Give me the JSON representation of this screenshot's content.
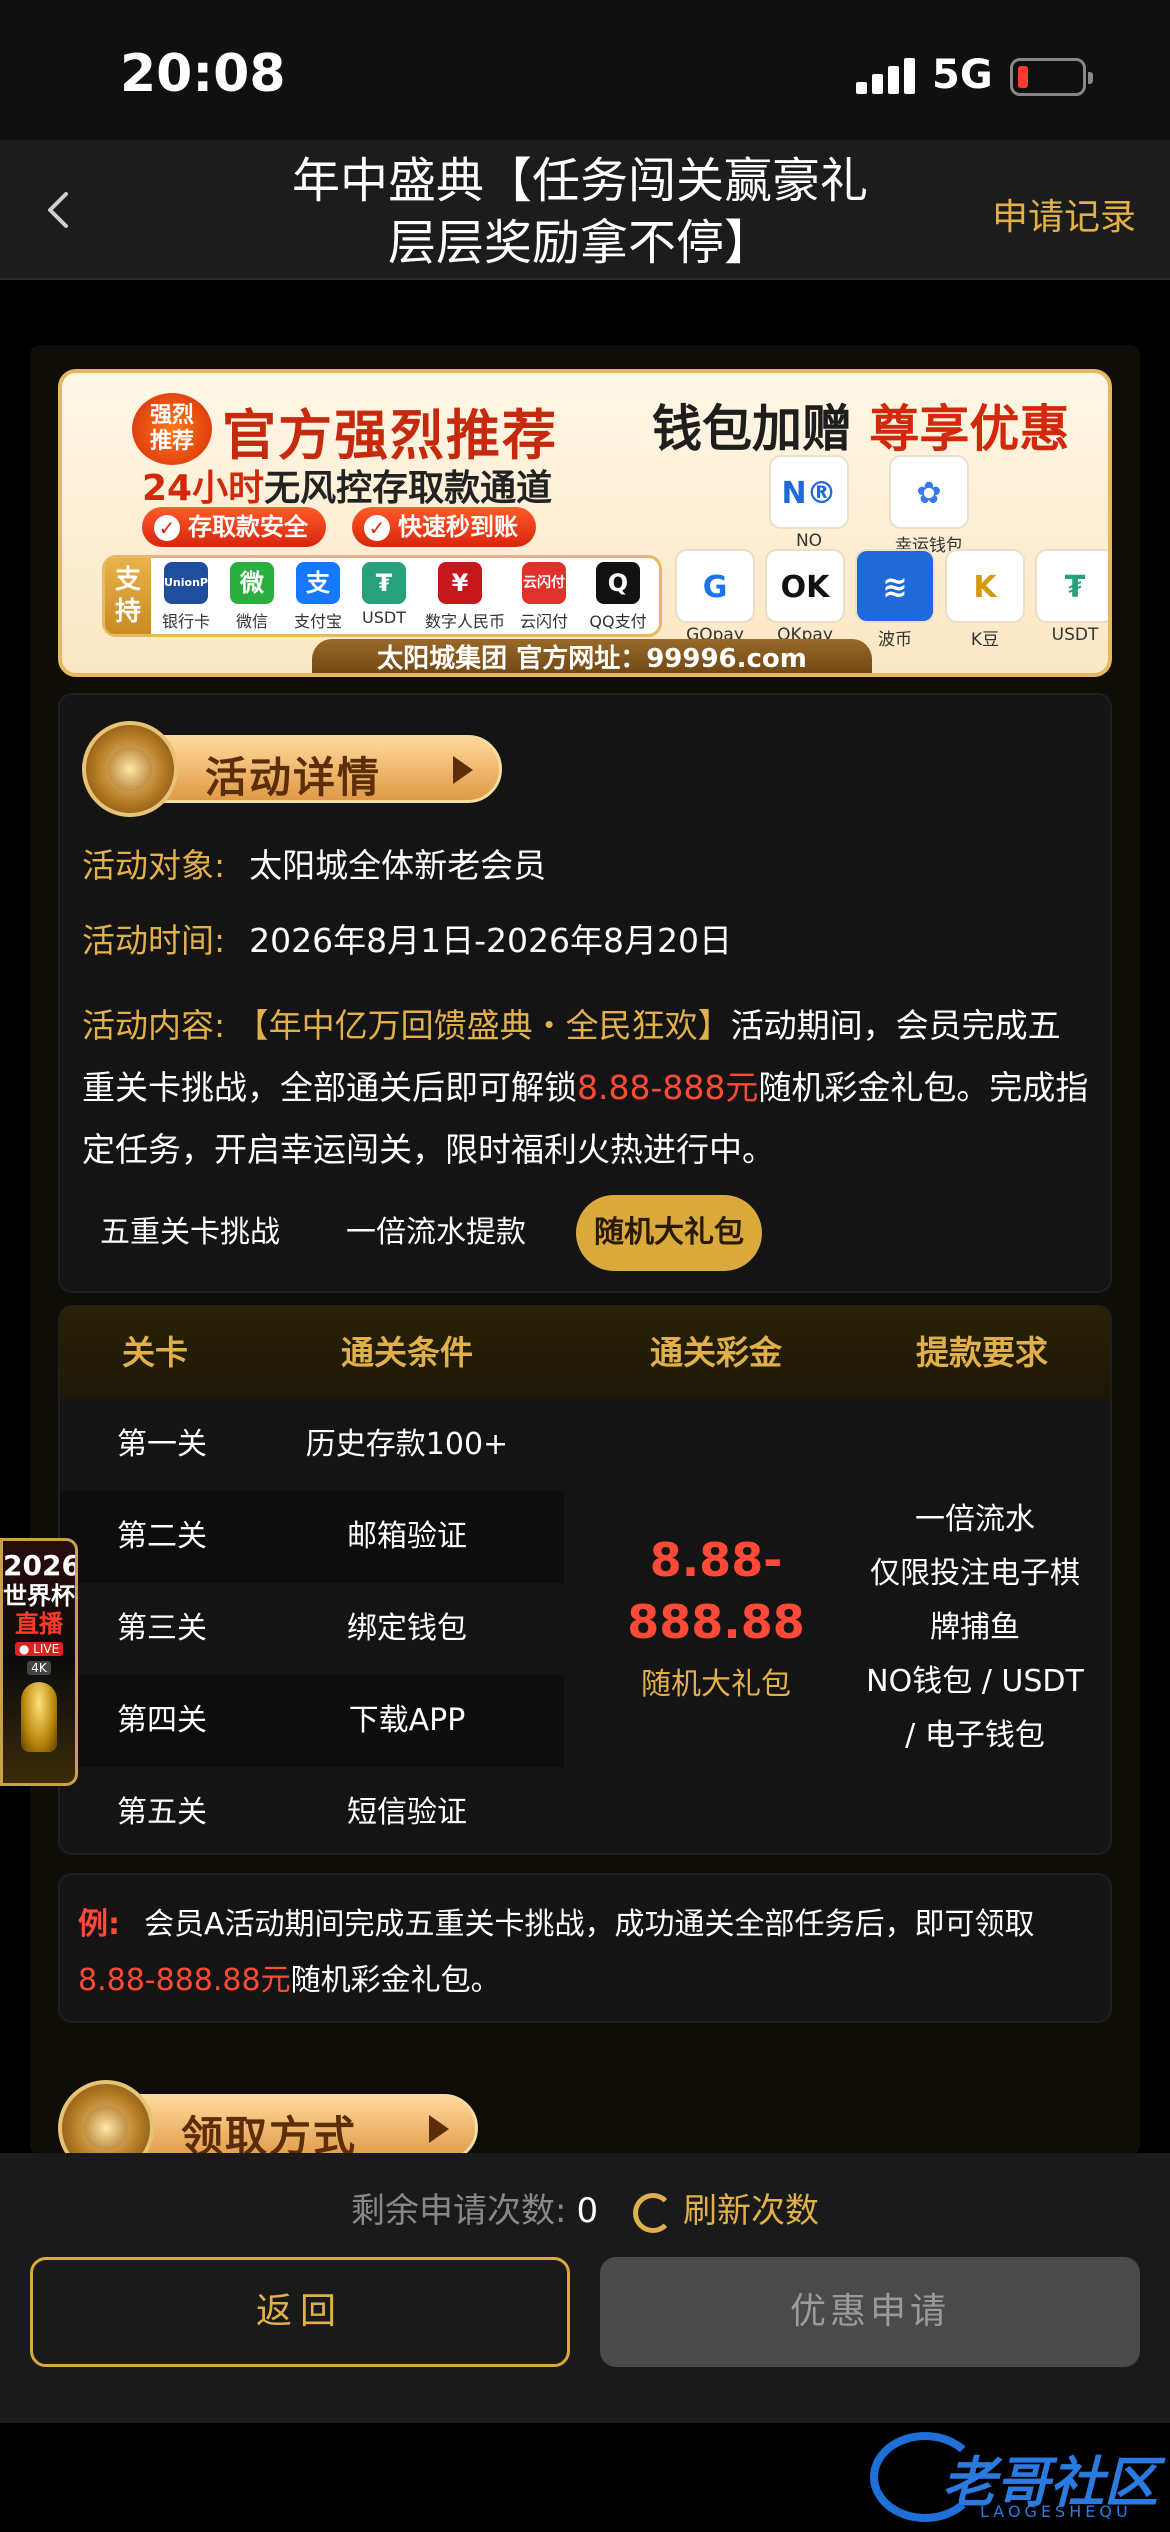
{
  "status_bar": {
    "time": "20:08",
    "network": "5G",
    "battery_color": "#ff3b30"
  },
  "nav": {
    "title_line1": "年中盛典【任务闯关赢豪礼",
    "title_line2": "层层奖励拿不停】",
    "record_label": "申请记录",
    "back_icon": "chevron-left-icon"
  },
  "banner": {
    "badge_line1": "强烈",
    "badge_line2": "推荐",
    "title": "官方强烈推荐",
    "sub_prefix": "24小时",
    "sub_rest": "无风控存取款通道",
    "pill1": "存取款安全",
    "pill2": "快速秒到账",
    "pay_label_1": "支",
    "pay_label_2": "持",
    "pay_methods": [
      {
        "icon": "UnionPay",
        "label": "银行卡",
        "color": "#1f4e9c"
      },
      {
        "icon": "微",
        "label": "微信",
        "color": "#2aae3e"
      },
      {
        "icon": "支",
        "label": "支付宝",
        "color": "#1677ff"
      },
      {
        "icon": "₮",
        "label": "USDT",
        "color": "#26a17b"
      },
      {
        "icon": "¥",
        "label": "数字人民币",
        "color": "#c8161d"
      },
      {
        "icon": "云闪付",
        "label": "云闪付",
        "color": "#e0322a"
      },
      {
        "icon": "Q",
        "label": "QQ支付",
        "color": "#111111"
      }
    ],
    "footer_brand": "太阳城集团",
    "footer_url": "官方网址：99996.com",
    "wallet_title_plain": "钱包加赠",
    "wallet_title_red": "尊享优惠",
    "wallets_top": [
      {
        "icon": "N®",
        "label": "NO"
      },
      {
        "icon": "✿",
        "label": "幸运钱包"
      }
    ],
    "wallets_bottom": [
      {
        "icon": "G",
        "label": "GOpay"
      },
      {
        "icon": "OK",
        "label": "OKpay"
      },
      {
        "icon": "≋",
        "label": "波币"
      },
      {
        "icon": "K",
        "label": "K豆"
      },
      {
        "icon": "₮",
        "label": "USDT"
      }
    ]
  },
  "details": {
    "section_title": "活动详情",
    "target_key": "活动对象:",
    "target_val": "太阳城全体新老会员",
    "time_key": "活动时间:",
    "time_val": "2026年8月1日-2026年8月20日",
    "content_key": "活动内容:",
    "content_gold": "【年中亿万回馈盛典・全民狂欢】",
    "content_p1": "活动期间，会员完成五重关卡挑战，全部通关后即可解锁",
    "content_red": "8.88-888元",
    "content_p2": "随机彩金礼包。完成指定任务，开启幸运闯关，限时福利火热进行中。",
    "tabs": [
      "五重关卡挑战",
      "一倍流水提款",
      "随机大礼包"
    ],
    "active_tab": 2
  },
  "table": {
    "headers": [
      "关卡",
      "通关条件",
      "通关彩金",
      "提款要求"
    ],
    "rows": [
      {
        "level": "第一关",
        "condition": "历史存款100+"
      },
      {
        "level": "第二关",
        "condition": "邮箱验证"
      },
      {
        "level": "第三关",
        "condition": "绑定钱包"
      },
      {
        "level": "第四关",
        "condition": "下载APP"
      },
      {
        "level": "第五关",
        "condition": "短信验证"
      }
    ],
    "prize_line1": "8.88-",
    "prize_line2": "888.88",
    "prize_label": "随机大礼包",
    "requirement_lines": [
      "一倍流水",
      "仅限投注电子棋",
      "牌捕鱼",
      "NO钱包 / USDT",
      "/ 电子钱包"
    ]
  },
  "example": {
    "label": "例:",
    "text": "会员A活动期间完成五重关卡挑战，成功通关全部任务后，即可领取",
    "red": "8.88-888.88元",
    "tail": "随机彩金礼包。"
  },
  "claim": {
    "section_title": "领取方式"
  },
  "worldcup": {
    "year": "2026",
    "line1": "世界杯",
    "line2": "直播",
    "live": "● LIVE",
    "res": "4K"
  },
  "bottom": {
    "remain_label": "剩余申请次数:",
    "remain_count": "0",
    "refresh_label": "刷新次数",
    "back_button": "返回",
    "apply_button": "优惠申请"
  },
  "watermark": {
    "text": "老哥社区",
    "sub": "LAOGESHEQU"
  },
  "colors": {
    "gold": "#e2b04a",
    "red": "#ff4a38",
    "active_tab": "#d9a93c"
  }
}
